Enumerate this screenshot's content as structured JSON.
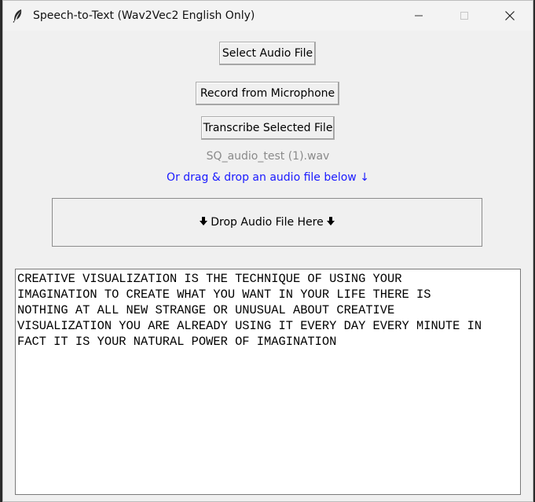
{
  "window": {
    "title": "Speech-to-Text (Wav2Vec2 English Only)",
    "icon": "feather-icon",
    "controls": {
      "minimize": "—",
      "maximize": "□",
      "close": "✕"
    }
  },
  "buttons": {
    "select_audio": "Select Audio File",
    "record_mic": "Record from Microphone",
    "transcribe": "Transcribe Selected File"
  },
  "status": {
    "selected_file": "SQ_audio_test (1).wav",
    "hint": "Or drag & drop an audio file below ↓"
  },
  "drop_zone": {
    "label": "Drop Audio File Here",
    "arrow_left": "🡻",
    "arrow_right": "🡻"
  },
  "transcript": {
    "text": "CREATIVE VISUALIZATION IS THE TECHNIQUE OF USING YOUR\nIMAGINATION TO CREATE WHAT YOU WANT IN YOUR LIFE THERE IS\nNOTHING AT ALL NEW STRANGE OR UNUSUAL ABOUT CREATIVE\nVISUALIZATION YOU ARE ALREADY USING IT EVERY DAY EVERY MINUTE IN\nFACT IT IS YOUR NATURAL POWER OF IMAGINATION"
  },
  "colors": {
    "hint_text": "#1a1aff",
    "file_label": "#8a8a8a",
    "window_bg": "#f0f0f0"
  }
}
